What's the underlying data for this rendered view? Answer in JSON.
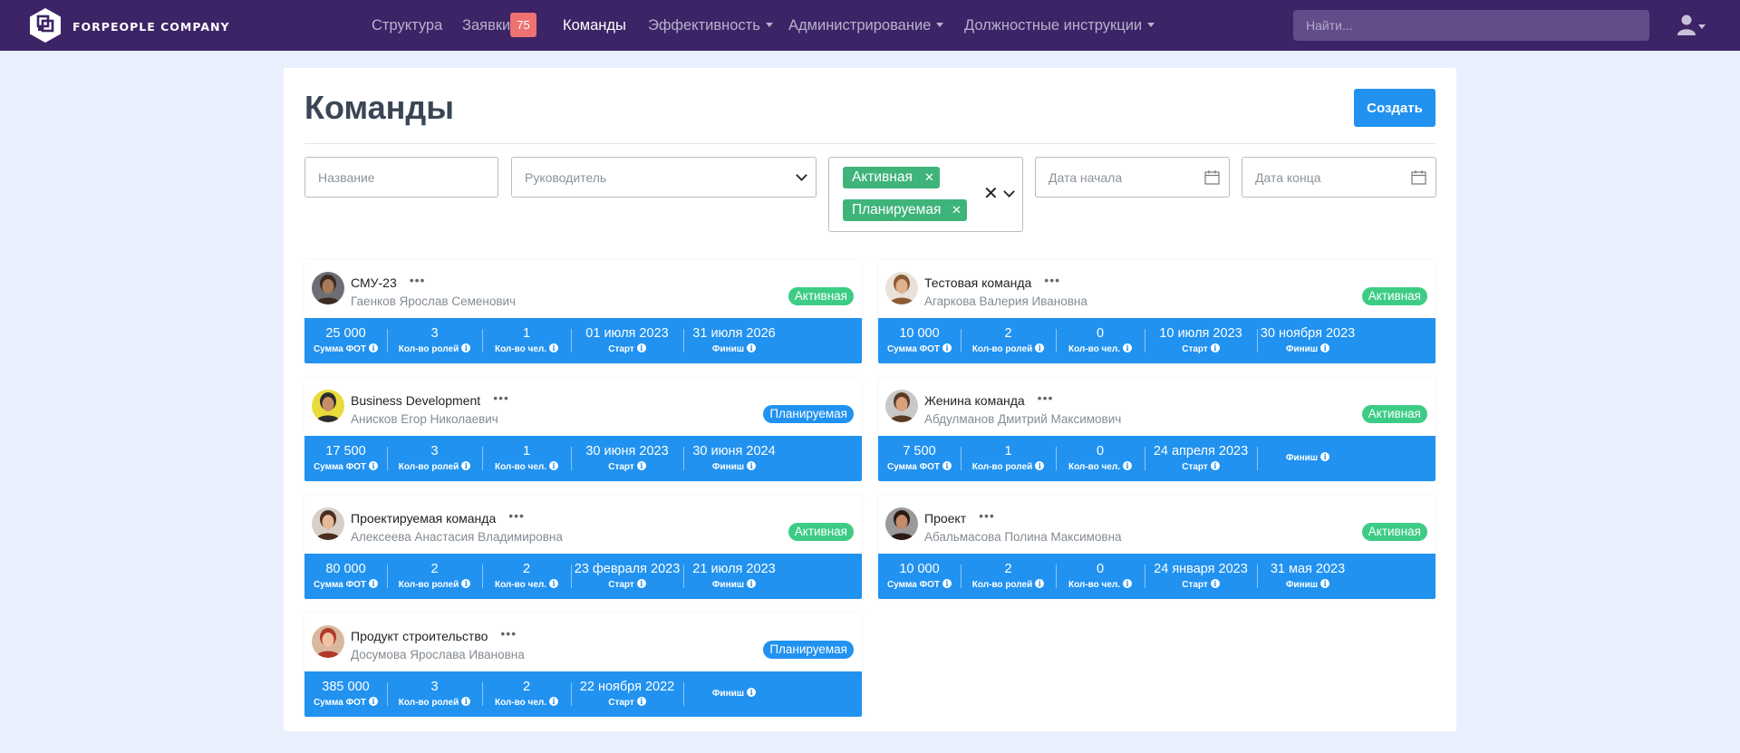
{
  "nav": {
    "brand": "FORPEOPLE COMPANY",
    "items": [
      {
        "label": "Структура",
        "dropdown": false
      },
      {
        "label": "Заявки",
        "dropdown": false,
        "badge": "75"
      },
      {
        "label": "Команды",
        "dropdown": false,
        "active": true
      },
      {
        "label": "Эффективность",
        "dropdown": true
      },
      {
        "label": "Администрирование",
        "dropdown": true
      },
      {
        "label": "Должностные инструкции",
        "dropdown": true
      }
    ],
    "search_placeholder": "Найти...",
    "colors": {
      "bar": "#3c2466",
      "badge": "#ee7271"
    }
  },
  "page": {
    "title": "Команды",
    "create_label": "Создать"
  },
  "filters": {
    "name_placeholder": "Название",
    "leader_placeholder": "Руководитель",
    "status_selected": [
      "Активная",
      "Планируемая"
    ],
    "start_placeholder": "Дата начала",
    "end_placeholder": "Дата конца"
  },
  "labels": {
    "payroll": "Сумма ФОТ",
    "roles": "Кол-во ролей",
    "people": "Кол-во чел.",
    "start": "Старт",
    "finish": "Финиш"
  },
  "teams": [
    {
      "name": "СМУ-23",
      "leader": "Гаенков Ярослав Семенович",
      "status": "Активная",
      "status_kind": "active",
      "payroll": "25 000",
      "roles": "3",
      "people": "1",
      "start": "01 июля 2023",
      "finish": "31 июля 2026",
      "avatar": "man-beard-icon"
    },
    {
      "name": "Тестовая команда",
      "leader": "Агаркова Валерия Ивановна",
      "status": "Активная",
      "status_kind": "active",
      "payroll": "10 000",
      "roles": "2",
      "people": "0",
      "start": "10 июля 2023",
      "finish": "30 ноября 2023",
      "avatar": "woman-long-hair-icon"
    },
    {
      "name": "Business Development",
      "leader": "Анисков Егор Николаевич",
      "status": "Планируемая",
      "status_kind": "planned",
      "payroll": "17 500",
      "roles": "3",
      "people": "1",
      "start": "30 июня 2023",
      "finish": "30 июня 2024",
      "avatar": "man-yellow-bg-icon"
    },
    {
      "name": "Женина команда",
      "leader": "Абдулманов Дмитрий Максимович",
      "status": "Активная",
      "status_kind": "active",
      "payroll": "7 500",
      "roles": "1",
      "people": "0",
      "start": "24 апреля 2023",
      "finish": "",
      "avatar": "man-smiling-icon"
    },
    {
      "name": "Проектируемая команда",
      "leader": "Алексеева Анастасия Владимировна",
      "status": "Активная",
      "status_kind": "active",
      "payroll": "80 000",
      "roles": "2",
      "people": "2",
      "start": "23 февраля 2023",
      "finish": "21 июля 2023",
      "avatar": "woman-dark-hair-icon"
    },
    {
      "name": "Проект",
      "leader": "Абальмасова Полина Максимовна",
      "status": "Активная",
      "status_kind": "active",
      "payroll": "10 000",
      "roles": "2",
      "people": "0",
      "start": "24 января 2023",
      "finish": "31 мая 2023",
      "avatar": "woman-portrait-icon"
    },
    {
      "name": "Продукт строительство",
      "leader": "Досумова Ярослава Ивановна",
      "status": "Планируемая",
      "status_kind": "planned",
      "payroll": "385 000",
      "roles": "3",
      "people": "2",
      "start": "22 ноября 2022",
      "finish": "",
      "avatar": "woman-red-hair-icon"
    }
  ]
}
